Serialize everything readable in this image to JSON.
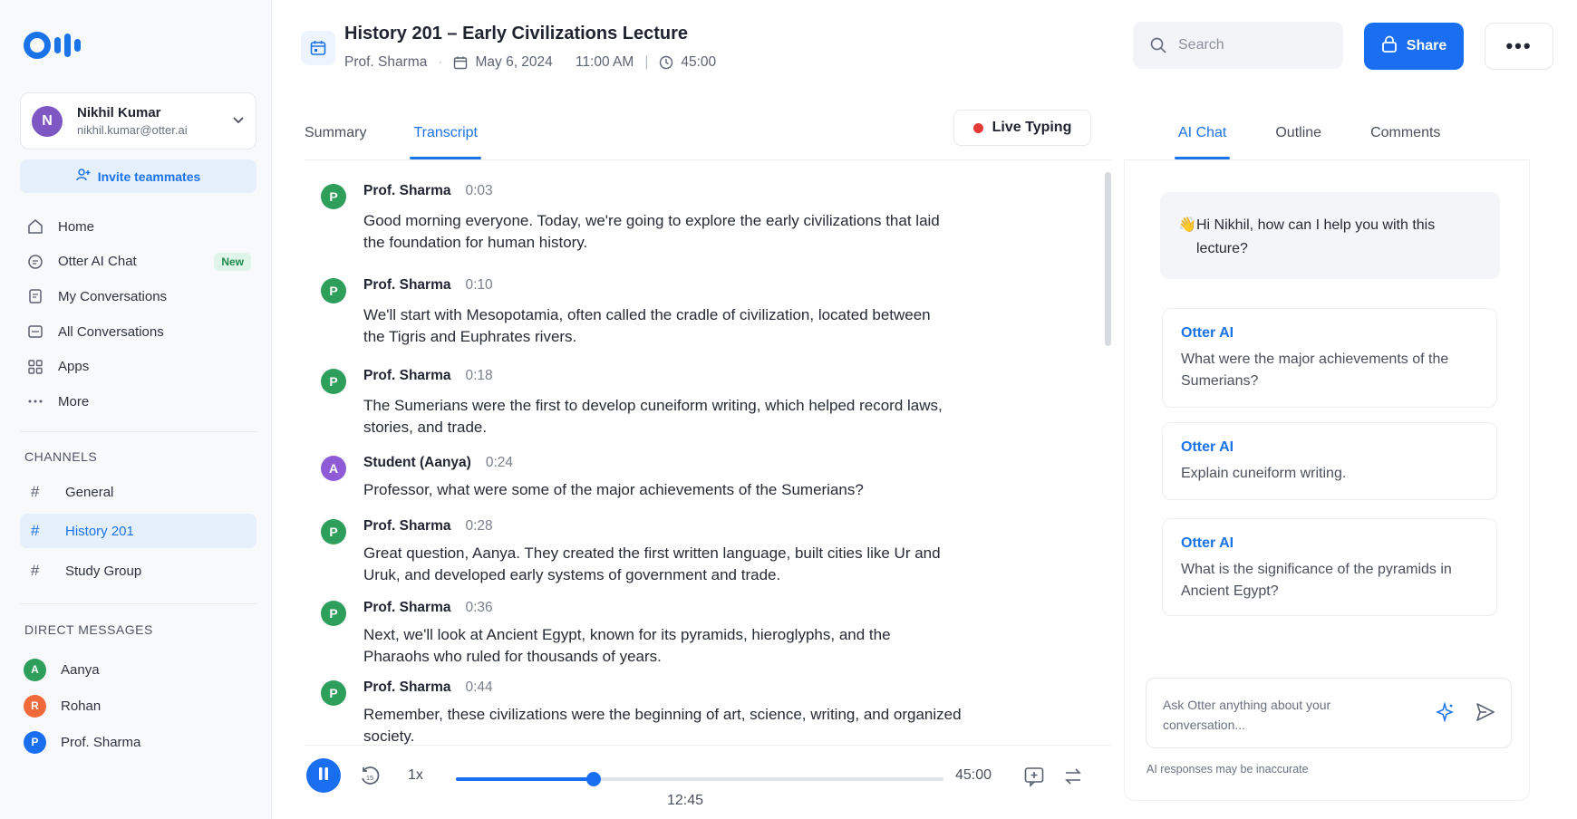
{
  "app": {
    "brand_color": "#1a73e8",
    "user": {
      "name": "Nikhil Kumar",
      "email": "nikhil.kumar@otter.ai",
      "initial": "N"
    },
    "invite_label": "Invite teammates"
  },
  "sidebar": {
    "nav": [
      {
        "label": "Home",
        "icon": "home-icon"
      },
      {
        "label": "Otter AI Chat",
        "icon": "chat-icon",
        "badge": "New"
      },
      {
        "label": "My Conversations",
        "icon": "conversation-icon"
      },
      {
        "label": "All Conversations",
        "icon": "folder-icon"
      },
      {
        "label": "Apps",
        "icon": "apps-grid-icon"
      },
      {
        "label": "More",
        "icon": "more-dots-icon"
      }
    ],
    "channels_title": "CHANNELS",
    "channels": [
      {
        "label": "General",
        "active": false
      },
      {
        "label": "History 201",
        "active": true
      },
      {
        "label": "Study Group",
        "active": false
      }
    ],
    "dm_title": "DIRECT MESSAGES",
    "dms": [
      {
        "label": "Aanya",
        "initial": "A",
        "color": "#2e9e5b"
      },
      {
        "label": "Rohan",
        "initial": "R",
        "color": "#f06a3a"
      },
      {
        "label": "Prof. Sharma",
        "initial": "P",
        "color": "#1a6ff0"
      }
    ]
  },
  "header": {
    "title": "History 201 – Early Civilizations Lecture",
    "speaker": "Prof. Sharma",
    "date": "May 6, 2024",
    "time": "11:00 AM",
    "duration": "45:00",
    "search_placeholder": "Search",
    "share_label": "Share"
  },
  "main": {
    "tabs": [
      "Summary",
      "Transcript"
    ],
    "active_tab": "Transcript",
    "live_label": "Live Typing",
    "transcript": [
      {
        "speaker": "Prof. Sharma",
        "initial": "P",
        "color": "#2e9e5b",
        "time": "0:03",
        "text": "Good morning everyone. Today, we're going to explore the early civilizations that laid the foundation for human history."
      },
      {
        "speaker": "Prof. Sharma",
        "initial": "P",
        "color": "#2e9e5b",
        "time": "0:10",
        "text": "We'll start with Mesopotamia, often called the cradle of civilization, located between the Tigris and Euphrates rivers."
      },
      {
        "speaker": "Prof. Sharma",
        "initial": "P",
        "color": "#2e9e5b",
        "time": "0:18",
        "text": "The Sumerians were the first to develop cuneiform writing, which helped record laws, stories, and trade."
      },
      {
        "speaker": "Student (Aanya)",
        "initial": "A",
        "color": "#8e5ad6",
        "time": "0:24",
        "text": "Professor, what were some of the major achievements of the Sumerians?"
      },
      {
        "speaker": "Prof. Sharma",
        "initial": "P",
        "color": "#2e9e5b",
        "time": "0:28",
        "text": "Great question, Aanya. They created the first written language, built cities like Ur and Uruk, and developed early systems of government and trade."
      },
      {
        "speaker": "Prof. Sharma",
        "initial": "P",
        "color": "#2e9e5b",
        "time": "0:36",
        "text": "Next, we'll look at Ancient Egypt, known for its pyramids, hieroglyphs, and the Pharaohs who ruled for thousands of years."
      },
      {
        "speaker": "Prof. Sharma",
        "initial": "P",
        "color": "#2e9e5b",
        "time": "0:44",
        "text": "Remember, these civilizations were the beginning of art, science, writing, and organized society."
      }
    ],
    "player": {
      "speed": "1x",
      "current_time": "12:45",
      "duration": "45:00",
      "progress": 0.2833
    }
  },
  "right_panel": {
    "tabs": [
      "AI Chat",
      "Outline",
      "Comments"
    ],
    "active_tab": "AI Chat",
    "greeting": "Hi Nikhil, how can I help you with this lecture?",
    "suggestions": [
      {
        "label": "Otter AI",
        "question": "What were the major achievements of the Sumerians?"
      },
      {
        "label": "Otter AI",
        "question": "Explain cuneiform writing."
      },
      {
        "label": "Otter AI",
        "question": "What is the significance of the pyramids in Ancient Egypt?"
      }
    ],
    "ask_placeholder": "Ask Otter anything about your conversation...",
    "disclaimer": "AI responses may be inaccurate"
  }
}
